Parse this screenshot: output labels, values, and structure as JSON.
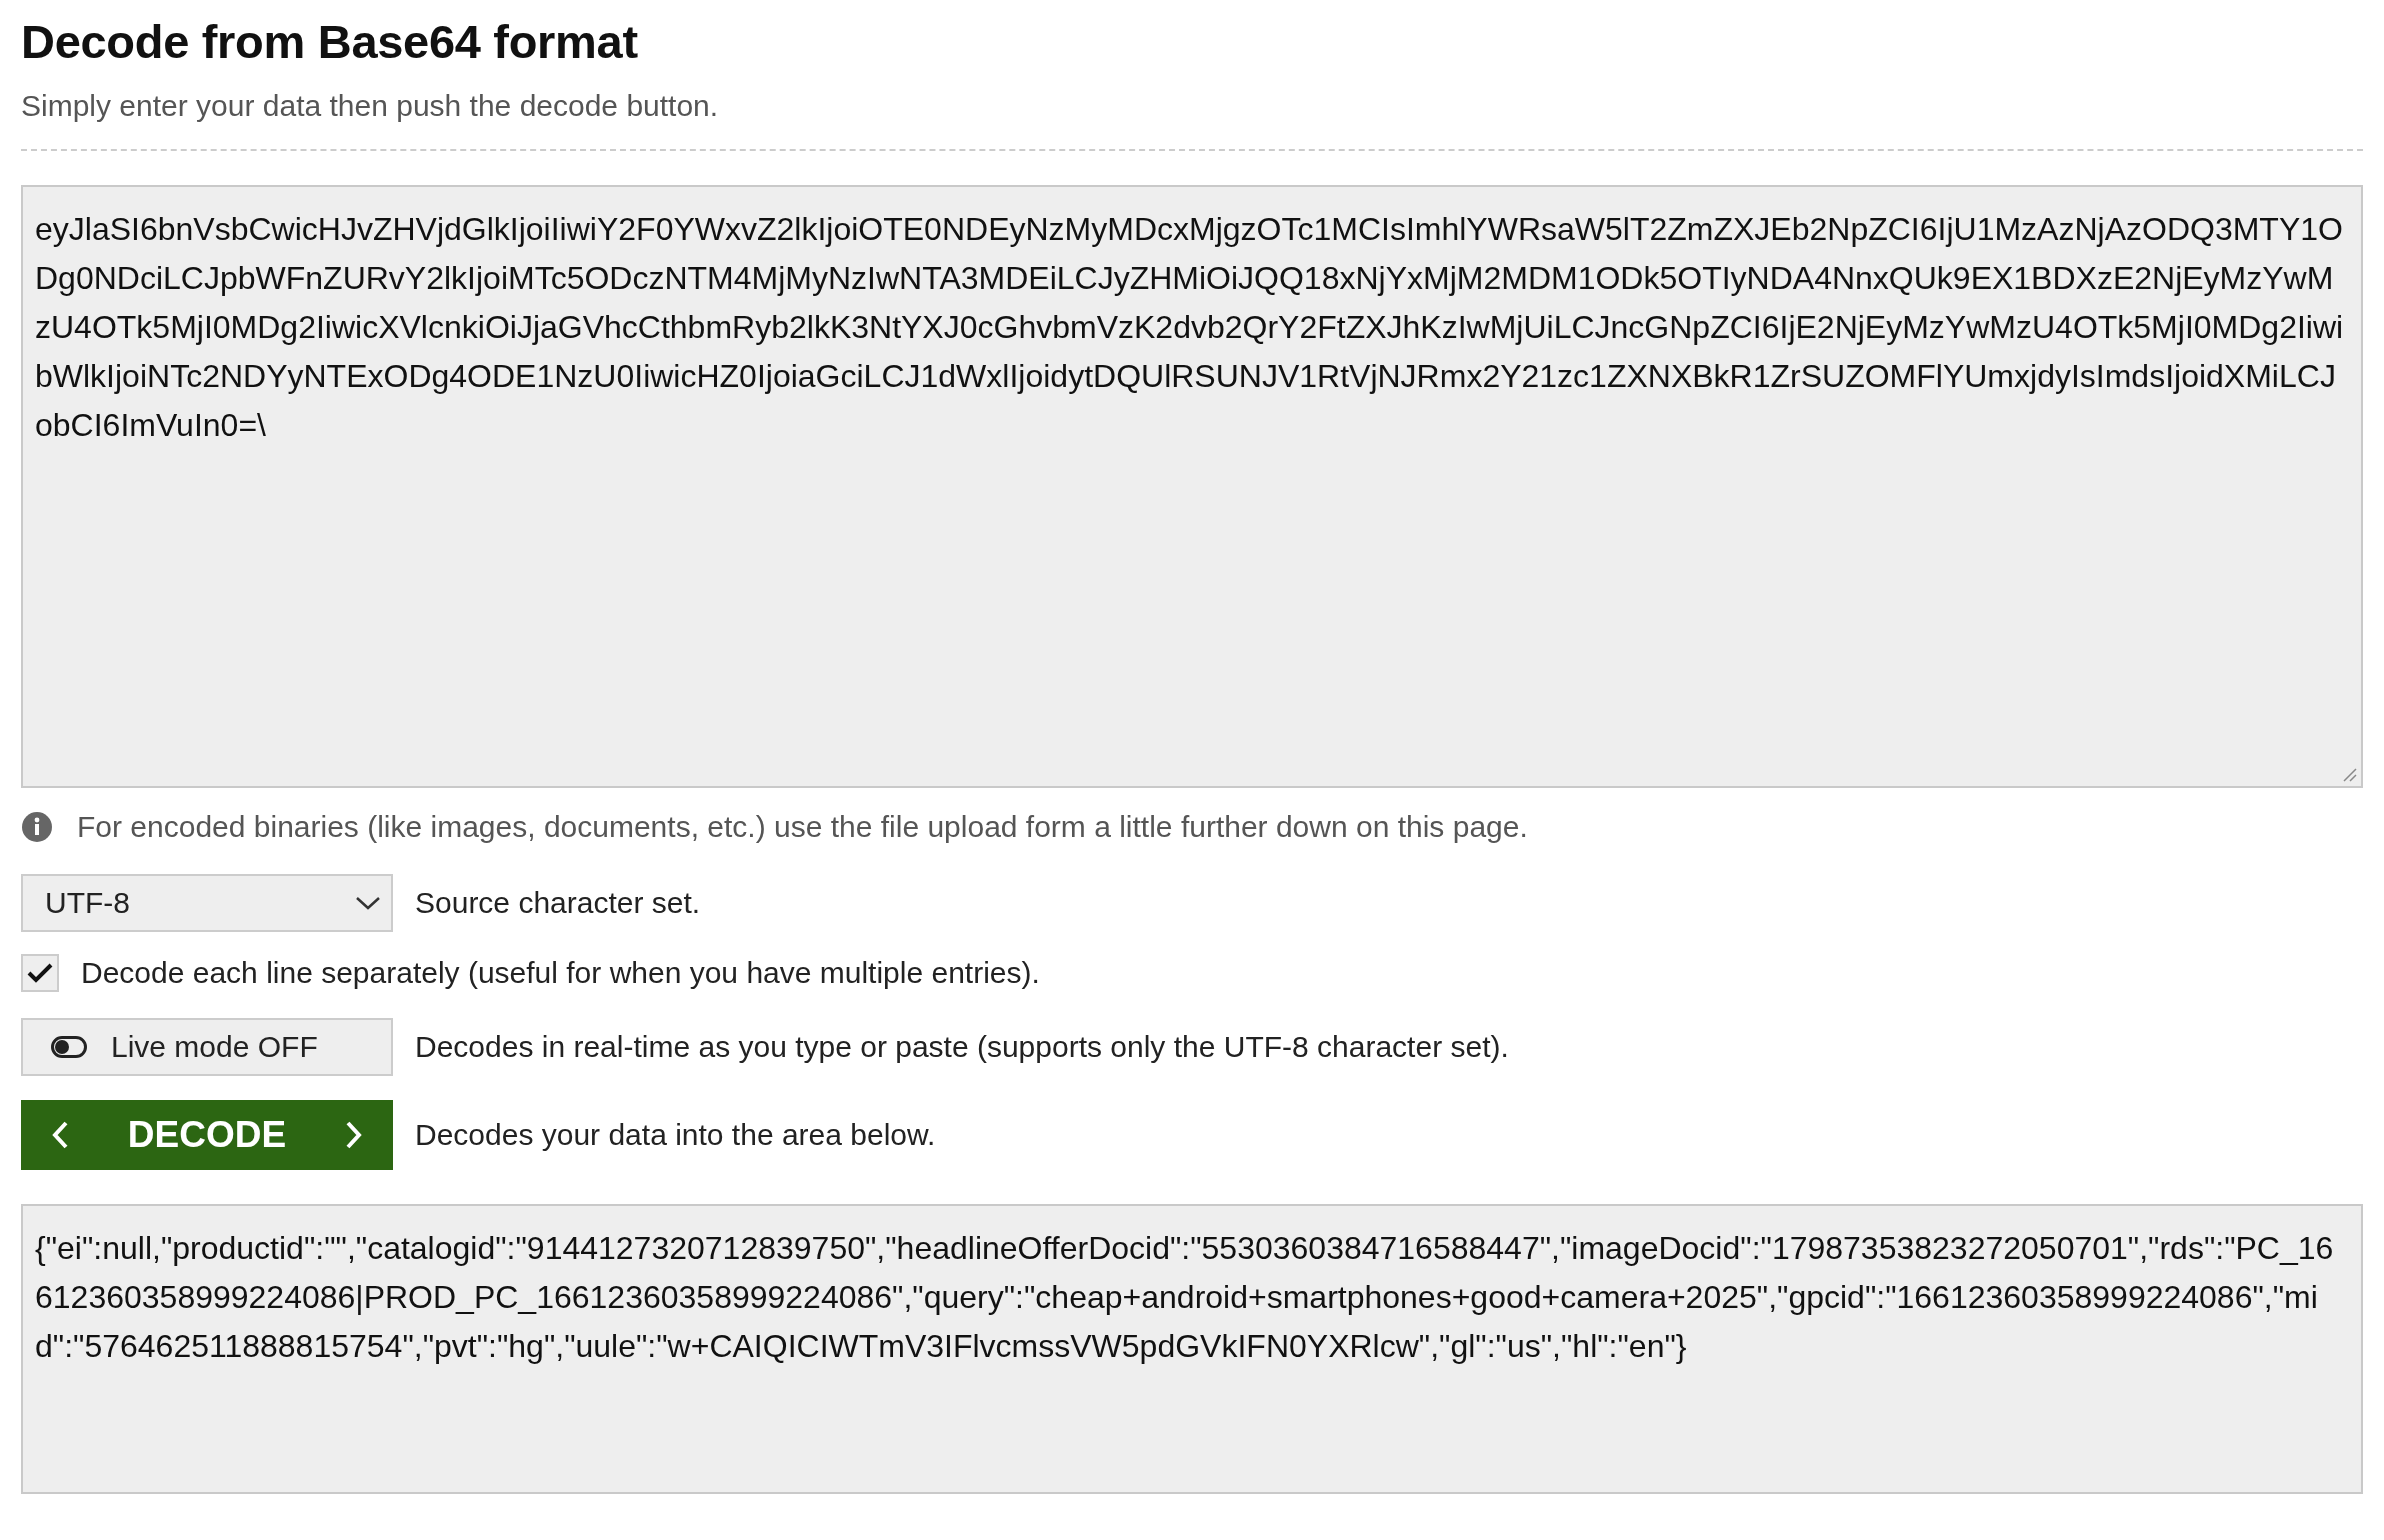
{
  "title": "Decode from Base64 format",
  "subtitle": "Simply enter your data then push the decode button.",
  "input": {
    "value": "eyJlaSI6bnVsbCwicHJvZHVjdGlkIjoiIiwiY2F0YWxvZ2lkIjoiOTE0NDEyNzMyMDcxMjgzOTc1MCIsImhlYWRsaW5lT2ZmZXJEb2NpZCI6IjU1MzAzNjAzODQ3MTY1ODg0NDciLCJpbWFnZURvY2lkIjoiMTc5ODczNTM4MjMyNzIwNTA3MDEiLCJyZHMiOiJQQ18xNjYxMjM2MDM1ODk5OTIyNDA4NnxQUk9EX1BDXzE2NjEyMzYwMzU4OTk5MjI0MDg2IiwicXVlcnkiOiJjaGVhcCthbmRyb2lkK3NtYXJ0cGhvbmVzK2dvb2QrY2FtZXJhKzIwMjUiLCJncGNpZCI6IjE2NjEyMzYwMzU4OTk5MjI0MDg2IiwibWlkIjoiNTc2NDYyNTExODg4ODE1NzU0IiwicHZ0IjoiaGciLCJ1dWxlIjoidytDQUlRSUNJV1RtVjNJRmx2Y21zc1ZXNXBkR1ZrSUZOMFlYUmxjdyIsImdsIjoidXMiLCJobCI6ImVuIn0=\\"
  },
  "info_note": "For encoded binaries (like images, documents, etc.) use the file upload form a little further down on this page.",
  "charset": {
    "value": "UTF-8",
    "label": "Source character set."
  },
  "decode_each_line": {
    "checked": true,
    "label": "Decode each line separately (useful for when you have multiple entries)."
  },
  "live_mode": {
    "on": false,
    "label": "Live mode OFF",
    "description": "Decodes in real-time as you type or paste (supports only the UTF-8 character set)."
  },
  "decode_button": {
    "label": "DECODE",
    "description": "Decodes your data into the area below."
  },
  "output": {
    "value": "{\"ei\":null,\"productid\":\"\",\"catalogid\":\"9144127320712839750\",\"headlineOfferDocid\":\"5530360384716588447\",\"imageDocid\":\"17987353823272050701\",\"rds\":\"PC_16612360358999224086|PROD_PC_16612360358999224086\",\"query\":\"cheap+android+smartphones+good+camera+2025\",\"gpcid\":\"16612360358999224086\",\"mid\":\"576462511888815754\",\"pvt\":\"hg\",\"uule\":\"w+CAIQICIWTmV3IFlvcmssVW5pdGVkIFN0YXRlcw\",\"gl\":\"us\",\"hl\":\"en\"}"
  }
}
